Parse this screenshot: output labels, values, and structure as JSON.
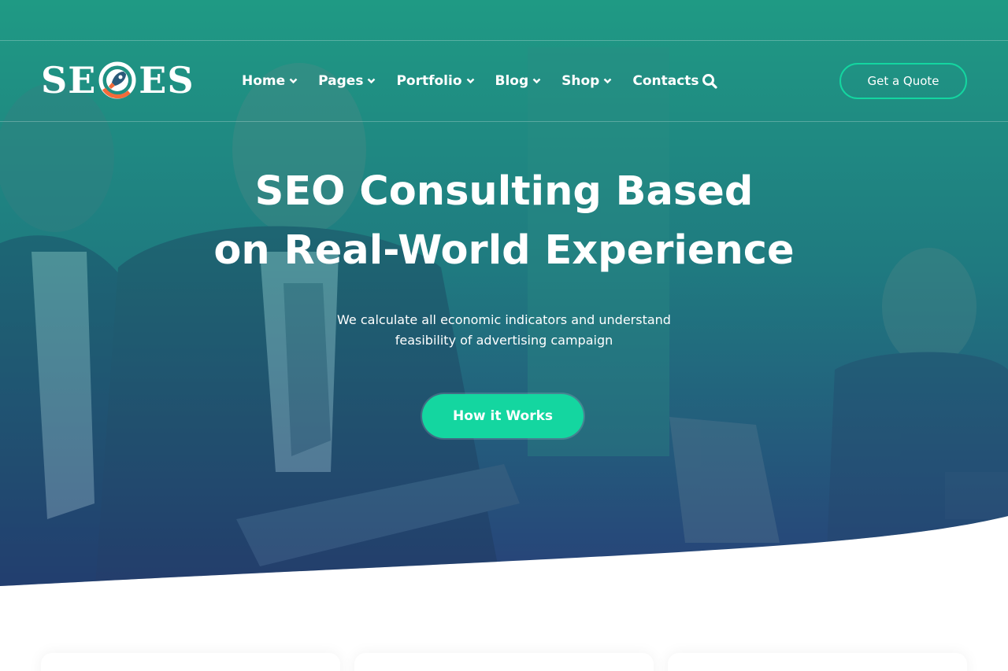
{
  "brand": {
    "logo_text_left": "SE",
    "logo_text_right": "ES"
  },
  "nav": {
    "items": [
      {
        "label": "Home",
        "has_dropdown": true
      },
      {
        "label": "Pages",
        "has_dropdown": true
      },
      {
        "label": "Portfolio",
        "has_dropdown": true
      },
      {
        "label": "Blog",
        "has_dropdown": true
      },
      {
        "label": "Shop",
        "has_dropdown": true
      },
      {
        "label": "Contacts",
        "has_dropdown": false
      }
    ],
    "search_icon": "search-icon"
  },
  "header": {
    "quote_button": "Get a Quote"
  },
  "hero": {
    "title_line1": "SEO Consulting Based",
    "title_line2": "on Real-World Experience",
    "subtitle_line1": "We calculate all economic indicators and understand",
    "subtitle_line2": "feasibility of advertising campaign",
    "cta": "How it Works"
  },
  "colors": {
    "accent": "#14d6a0",
    "hero_top": "#1f9a84",
    "hero_bottom": "#283f78",
    "text": "#ffffff"
  }
}
